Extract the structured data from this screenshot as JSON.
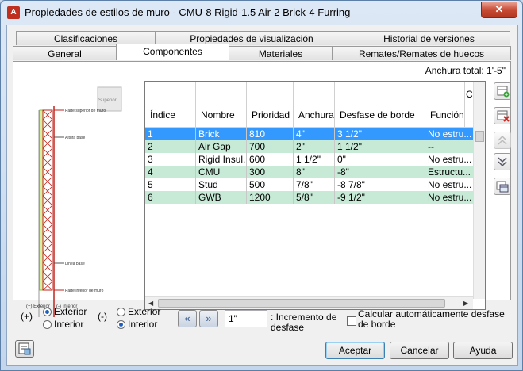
{
  "window": {
    "title": "Propiedades de estilos de muro - CMU-8 Rigid-1.5 Air-2 Brick-4 Furring",
    "close_glyph": "✕",
    "app_icon_glyph": "A"
  },
  "tabs_row1": [
    {
      "label": "Clasificaciones"
    },
    {
      "label": "Propiedades de visualización"
    },
    {
      "label": "Historial de versiones"
    }
  ],
  "tabs_row2": [
    {
      "label": "General"
    },
    {
      "label": "Componentes"
    },
    {
      "label": "Materiales"
    },
    {
      "label": "Remates/Remates de huecos"
    }
  ],
  "total_width": "Anchura total: 1'-5\"",
  "preview": {
    "labels": [
      "Parte superior de muro",
      "Altura base",
      "Línea base",
      "Parte inferior de muro"
    ],
    "bottom_left": "(+)\nExterior",
    "bottom_right": "(-)\nInterior",
    "overlay_label": "Superior"
  },
  "table": {
    "headers": {
      "index": "Índice",
      "name": "Nombre",
      "priority": "Prioridad",
      "width": "Anchura",
      "offset": "Desfase de borde",
      "function": "Función",
      "extra": "Co"
    },
    "rows": [
      {
        "index": "1",
        "name": "Brick",
        "priority": "810",
        "width": "4\"",
        "offset": "3 1/2\"",
        "function": "No estru..."
      },
      {
        "index": "2",
        "name": "Air Gap",
        "priority": "700",
        "width": "2\"",
        "offset": "1 1/2\"",
        "function": "--"
      },
      {
        "index": "3",
        "name": "Rigid Insul...",
        "priority": "600",
        "width": "1 1/2\"",
        "offset": "0\"",
        "function": "No estru..."
      },
      {
        "index": "4",
        "name": "CMU",
        "priority": "300",
        "width": "8\"",
        "offset": "-8\"",
        "function": "Estructu..."
      },
      {
        "index": "5",
        "name": "Stud",
        "priority": "500",
        "width": "7/8\"",
        "offset": "-8 7/8\"",
        "function": "No estru..."
      },
      {
        "index": "6",
        "name": "GWB",
        "priority": "1200",
        "width": "5/8\"",
        "offset": "-9 1/2\"",
        "function": "No estru..."
      }
    ]
  },
  "options": {
    "group1_sign": "(+)",
    "group1": [
      {
        "label": "Exterior",
        "selected": true
      },
      {
        "label": "Interior",
        "selected": false
      }
    ],
    "group2_sign": "(-)",
    "group2": [
      {
        "label": "Exterior",
        "selected": false
      },
      {
        "label": "Interior",
        "selected": true
      }
    ],
    "increment_value": "1\"",
    "increment_label_1": ": Incremento de",
    "increment_label_2": "desfase",
    "auto_offset_label_1": "Calcular automáticamente desfase",
    "auto_offset_label_2": "de borde",
    "auto_offset_checked": false
  },
  "buttons": {
    "ok": "Aceptar",
    "cancel": "Cancelar",
    "help": "Ayuda"
  },
  "colors": {
    "selected_row": "#3399ff",
    "green_row": "#c6ead6",
    "accent_red": "#c0231c",
    "accent_green": "#4caf50"
  }
}
